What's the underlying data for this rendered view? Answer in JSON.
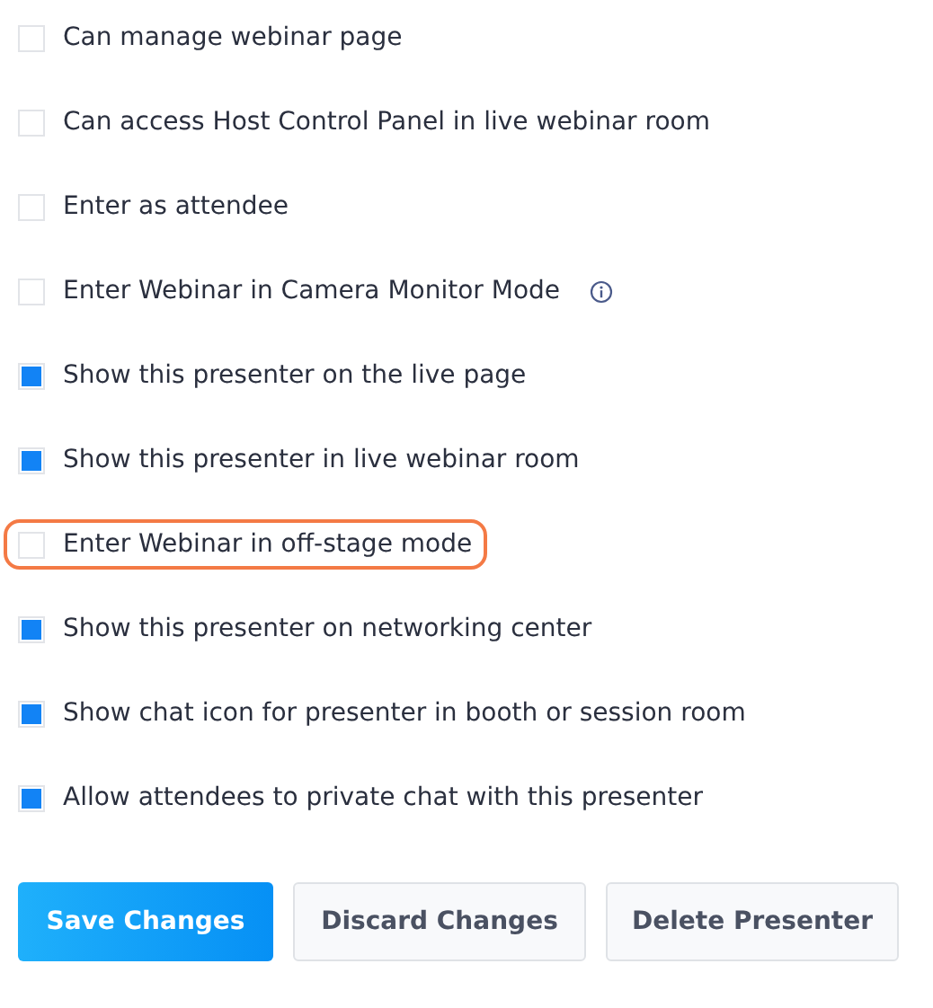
{
  "options": [
    {
      "label": "Can manage webinar page",
      "checked": false
    },
    {
      "label": "Can access Host Control Panel in live webinar room",
      "checked": false
    },
    {
      "label": "Enter as attendee",
      "checked": false
    },
    {
      "label": "Enter Webinar in Camera Monitor Mode",
      "checked": false,
      "info": true
    },
    {
      "label": "Show this presenter on the live page",
      "checked": true
    },
    {
      "label": "Show this presenter in live webinar room",
      "checked": true
    },
    {
      "label": "Enter Webinar in off-stage mode",
      "checked": false,
      "highlighted": true
    },
    {
      "label": "Show this presenter on networking center",
      "checked": true
    },
    {
      "label": "Show chat icon for presenter in booth or session room",
      "checked": true
    },
    {
      "label": "Allow attendees to private chat with this presenter",
      "checked": true
    }
  ],
  "buttons": [
    {
      "label": "Save Changes",
      "kind": "primary"
    },
    {
      "label": "Discard Changes",
      "kind": "secondary"
    },
    {
      "label": "Delete Presenter",
      "kind": "secondary"
    }
  ]
}
